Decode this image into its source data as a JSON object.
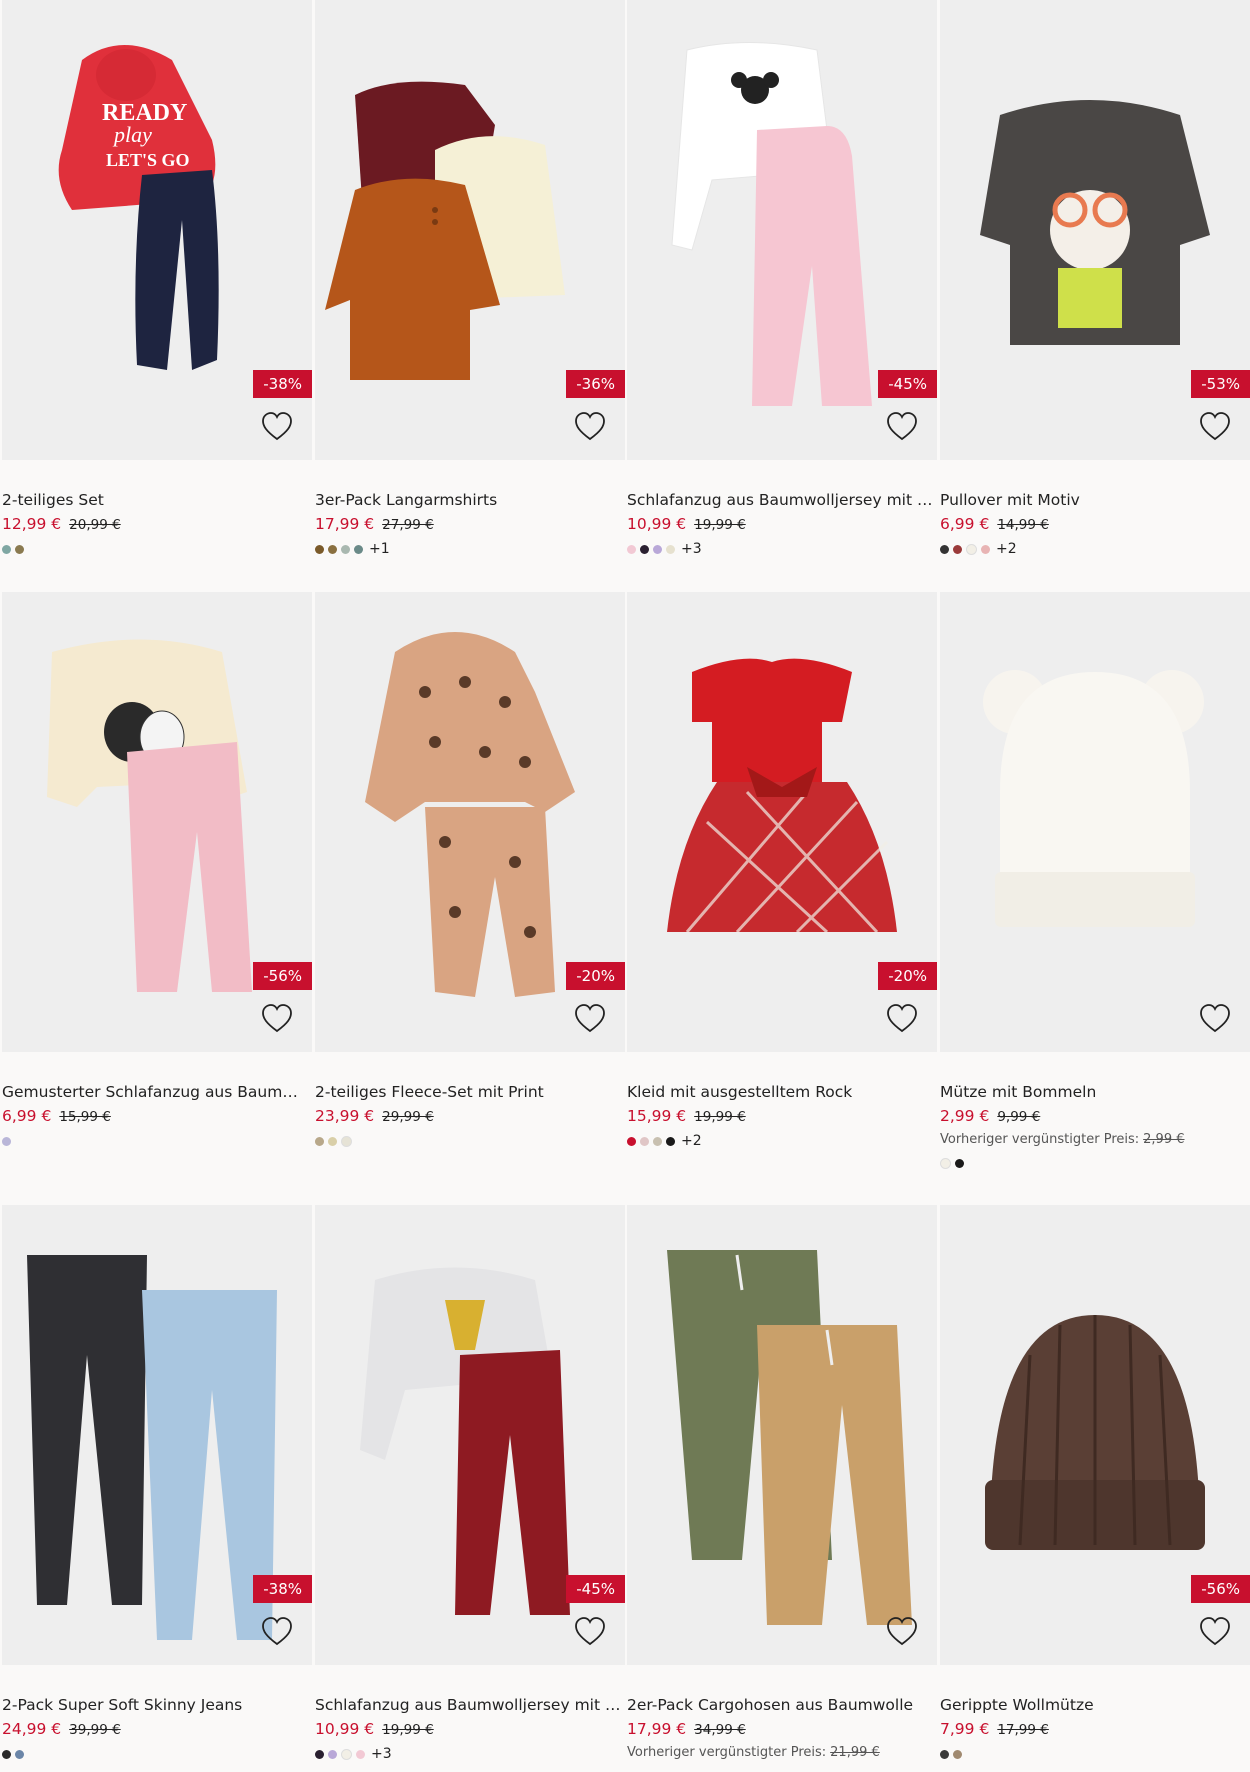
{
  "products": [
    {
      "title": "2-teiliges Set",
      "price": "12,99 €",
      "old_price": "20,99 €",
      "discount": "-38%",
      "swatches": [
        "#7fa7a3",
        "#8a7a50"
      ],
      "more": ""
    },
    {
      "title": "3er-Pack Langarmshirts",
      "price": "17,99 €",
      "old_price": "27,99 €",
      "discount": "-36%",
      "swatches": [
        "#7a5a2a",
        "#8a7040",
        "#a9b8b0",
        "#6a8a88"
      ],
      "more": "+1"
    },
    {
      "title": "Schlafanzug aus Baumwolljersey mit Pri...",
      "price": "10,99 €",
      "old_price": "19,99 €",
      "discount": "-45%",
      "swatches": [
        "#f2c9d4",
        "#2a2030",
        "#b9a8d8",
        "#e6e1cf"
      ],
      "more": "+3"
    },
    {
      "title": "Pullover mit Motiv",
      "price": "6,99 €",
      "old_price": "14,99 €",
      "discount": "-53%",
      "swatches": [
        "#333333",
        "#9a3a3a",
        "#f2efe6",
        "#e8b4b4"
      ],
      "more": "+2"
    },
    {
      "title": "Gemusterter Schlafanzug aus Baumwol...",
      "price": "6,99 €",
      "old_price": "15,99 €",
      "discount": "-56%",
      "swatches": [
        "#b9b6d8"
      ],
      "more": ""
    },
    {
      "title": "2-teiliges Fleece-Set mit Print",
      "price": "23,99 €",
      "old_price": "29,99 €",
      "discount": "-20%",
      "swatches": [
        "#b8a88a",
        "#d9cfa8",
        "#e6e3d6"
      ],
      "more": ""
    },
    {
      "title": "Kleid mit ausgestelltem Rock",
      "price": "15,99 €",
      "old_price": "19,99 €",
      "discount": "-20%",
      "swatches": [
        "#c8102e",
        "#e0c6c6",
        "#c8c0b0",
        "#1a1a1a"
      ],
      "more": "+2"
    },
    {
      "title": "Mütze mit Bommeln",
      "price": "2,99 €",
      "old_price": "9,99 €",
      "discount": "",
      "prev_label": "Vorheriger vergünstigter Preis:",
      "prev_value": "2,99 €",
      "swatches": [
        "#f2efe6",
        "#1a1a1a"
      ],
      "more": ""
    },
    {
      "title": "2-Pack Super Soft Skinny Jeans",
      "price": "24,99 €",
      "old_price": "39,99 €",
      "discount": "-38%",
      "swatches": [
        "#2a2a2a",
        "#6b86a8"
      ],
      "more": ""
    },
    {
      "title": "Schlafanzug aus Baumwolljersey mit Pri...",
      "price": "10,99 €",
      "old_price": "19,99 €",
      "discount": "-45%",
      "swatches": [
        "#2a2030",
        "#b9a8d8",
        "#f2efe6",
        "#f2c9d4"
      ],
      "more": "+3"
    },
    {
      "title": "2er-Pack Cargohosen aus Baumwolle",
      "price": "17,99 €",
      "old_price": "34,99 €",
      "discount": "",
      "prev_label": "Vorheriger vergünstigter Preis:",
      "prev_value": "21,99 €",
      "swatches": [],
      "more": ""
    },
    {
      "title": "Gerippte Wollmütze",
      "price": "7,99 €",
      "old_price": "17,99 €",
      "discount": "-56%",
      "swatches": [
        "#3a3a3a",
        "#a08a70"
      ],
      "more": ""
    }
  ]
}
